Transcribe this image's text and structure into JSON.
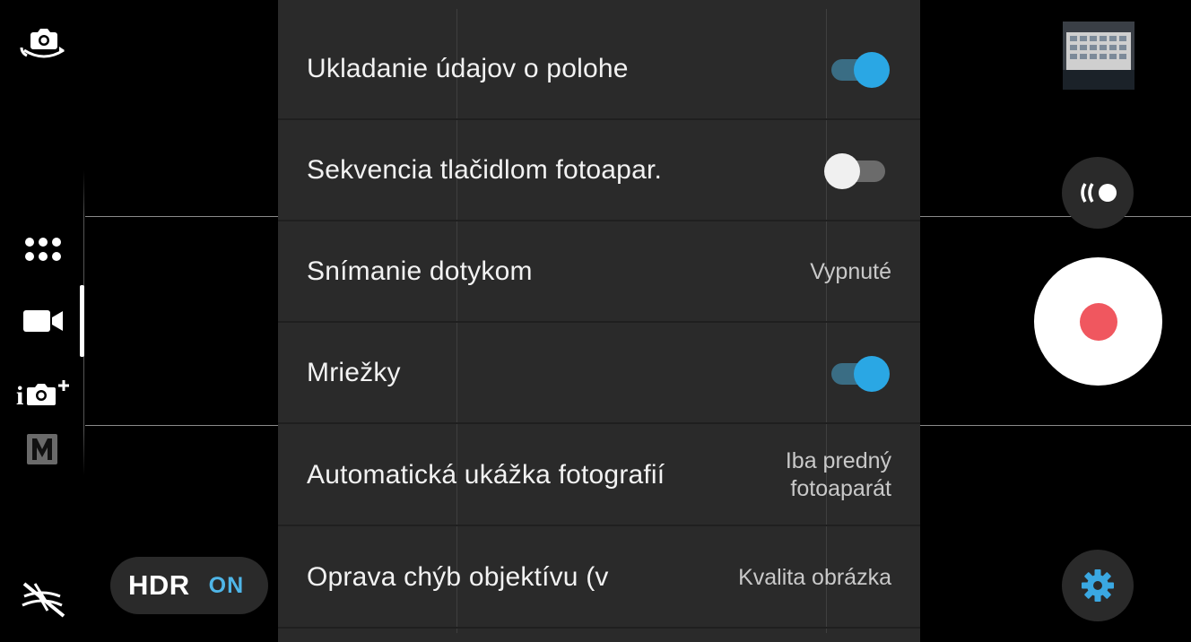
{
  "left_rail": {
    "camera_switch_icon": "camera-switch-icon",
    "modes": [
      {
        "name": "more-modes",
        "icon": "grid-dots-icon"
      },
      {
        "name": "video",
        "icon": "video-camera-icon",
        "selected": true
      },
      {
        "name": "intelligent-auto",
        "icon": "i-camera-plus-icon"
      },
      {
        "name": "manual",
        "icon": "m-icon",
        "glyph": "M"
      }
    ],
    "flash_icon": "flash-off-icon",
    "hdr": {
      "label": "HDR",
      "state": "ON"
    }
  },
  "settings": {
    "rows": [
      {
        "label": "Ukladanie údajov o polohe",
        "type": "toggle",
        "on": true
      },
      {
        "label": "Sekvencia tlačidlom fotoapar.",
        "type": "toggle",
        "on": false
      },
      {
        "label": "Snímanie dotykom",
        "type": "value",
        "value": "Vypnuté"
      },
      {
        "label": "Mriežky",
        "type": "toggle",
        "on": true
      },
      {
        "label": "Automatická ukážka fotografií",
        "type": "value",
        "value_line1": "Iba predný",
        "value_line2": "fotoaparát"
      },
      {
        "label": "Oprava chýb objektívu (v",
        "type": "value",
        "value": "Kvalita obrázka"
      }
    ]
  },
  "right_rail": {
    "gallery_thumbnail": "gallery-thumbnail",
    "timer_icon": "timer-wave-icon",
    "record_icon": "record-icon",
    "settings_icon": "gear-icon"
  },
  "colors": {
    "accent": "#2aa7e4",
    "record": "#f0575f",
    "panel": "#2a2a2a"
  }
}
